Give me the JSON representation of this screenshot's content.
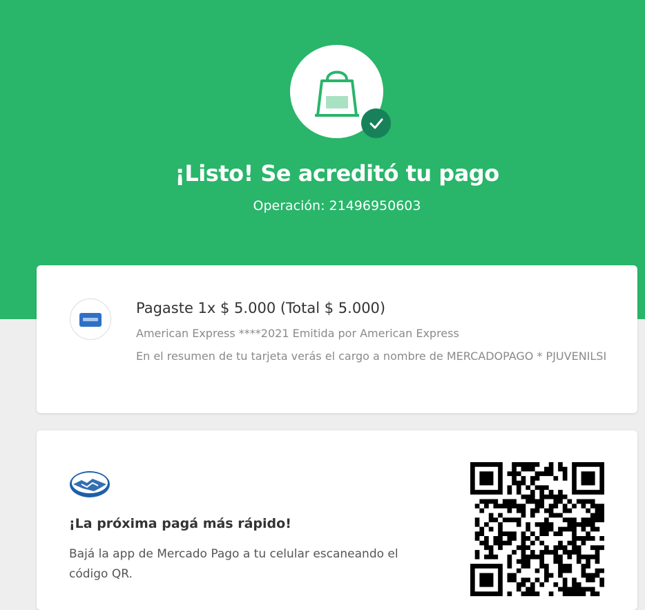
{
  "header": {
    "title": "¡Listo! Se acreditó tu pago",
    "operation": "Operación: 21496950603",
    "icon": "shopping-bag-icon",
    "badge_icon": "check-icon",
    "colors": {
      "background": "#29b56a",
      "badge": "#17815a"
    }
  },
  "payment": {
    "amount": "Pagaste 1x $ 5.000 (Total $ 5.000)",
    "card": "American Express ****2021 Emitida por American Express",
    "note": "En el resumen de tu tarjeta verás el cargo a nombre de MERCADOPAGO * PJUVENILSI",
    "logo_icon": "american-express-card-icon"
  },
  "app_promo": {
    "logo_icon": "mercado-pago-handshake-icon",
    "heading": "¡La próxima pagá más rápido!",
    "text": "Bajá la app de Mercado Pago a tu celular escaneando el código QR.",
    "qr_icon": "qr-code-icon"
  }
}
